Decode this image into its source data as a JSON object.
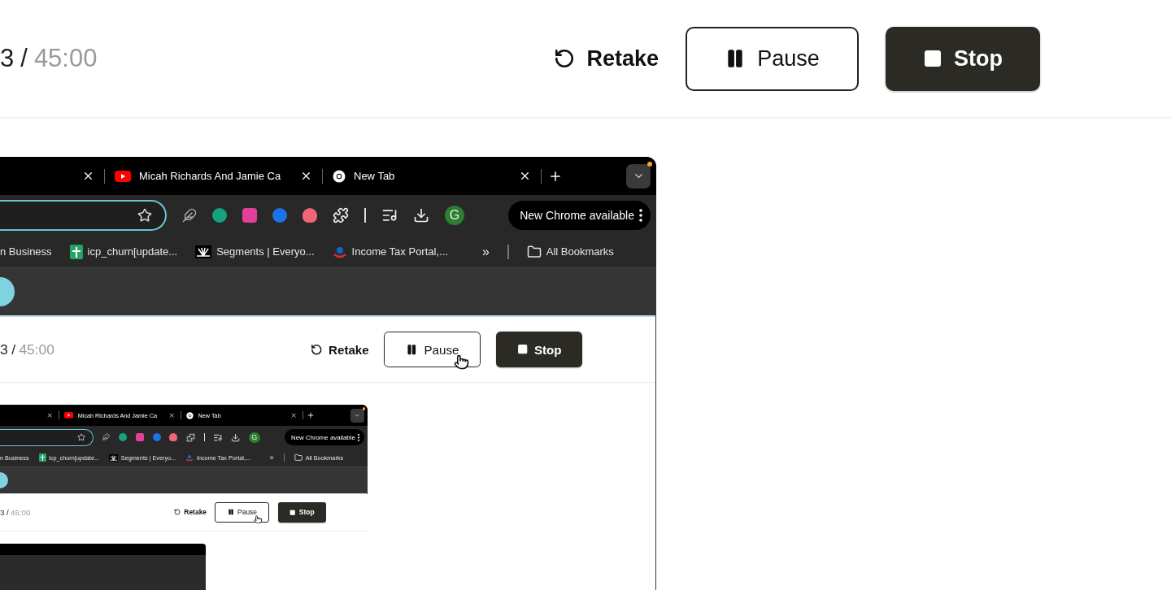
{
  "header": {
    "timer": {
      "elapsed": "3",
      "separator": "/",
      "total": "45:00"
    },
    "actions": [
      {
        "kind": "retake",
        "label": "Retake",
        "pointer": false
      },
      {
        "kind": "pause",
        "label": "Pause",
        "pointer": false
      },
      {
        "kind": "stop",
        "label": "Stop",
        "pointer": false
      }
    ]
  },
  "browser": {
    "tabs": [
      {
        "kind": "blank"
      },
      {
        "kind": "youtube",
        "title": "Micah Richards And Jamie Ca"
      },
      {
        "kind": "chrome",
        "title": "New Tab"
      }
    ],
    "toolbar": {
      "avatar": "G",
      "update_button": "New Chrome available"
    },
    "bookmarks": [
      {
        "kind": "plain",
        "label": "n Business"
      },
      {
        "kind": "sheets",
        "label": "icp_churn[update..."
      },
      {
        "kind": "segments",
        "label": "Segments | Everyo..."
      },
      {
        "kind": "tax",
        "label": "Income Tax Portal,..."
      }
    ],
    "bookmarks_overflow": "»",
    "all_bookmarks": "All Bookmarks",
    "page": {
      "header": {
        "timer": {
          "elapsed": "3",
          "separator": "/",
          "total": "45:00"
        },
        "actions": [
          {
            "kind": "retake",
            "label": "Retake",
            "pointer": false
          },
          {
            "kind": "pause",
            "label": "Pause",
            "pointer": true
          },
          {
            "kind": "stop",
            "label": "Stop",
            "pointer": false
          }
        ]
      },
      "browser": {
        "tabs": [
          {
            "kind": "blank"
          },
          {
            "kind": "youtube",
            "title": "Micah Richards And Jamie Ca"
          },
          {
            "kind": "chrome",
            "title": "New Tab"
          }
        ],
        "toolbar": {
          "avatar": "G",
          "update_button": "New Chrome available"
        },
        "bookmarks": [
          {
            "kind": "plain",
            "label": "n Business"
          },
          {
            "kind": "sheets",
            "label": "icp_churn[update..."
          },
          {
            "kind": "segments",
            "label": "Segments | Everyo..."
          },
          {
            "kind": "tax",
            "label": "Income Tax Portal,..."
          }
        ],
        "bookmarks_overflow": "»",
        "all_bookmarks": "All Bookmarks",
        "page": {
          "header": {
            "timer": {
              "elapsed": "3",
              "separator": "/",
              "total": "45:00"
            },
            "actions": [
              {
                "kind": "retake",
                "label": "Retake",
                "pointer": false
              },
              {
                "kind": "pause",
                "label": "Pause",
                "pointer": true
              },
              {
                "kind": "stop",
                "label": "Stop",
                "pointer": false
              }
            ]
          },
          "preview": true
        }
      }
    }
  }
}
